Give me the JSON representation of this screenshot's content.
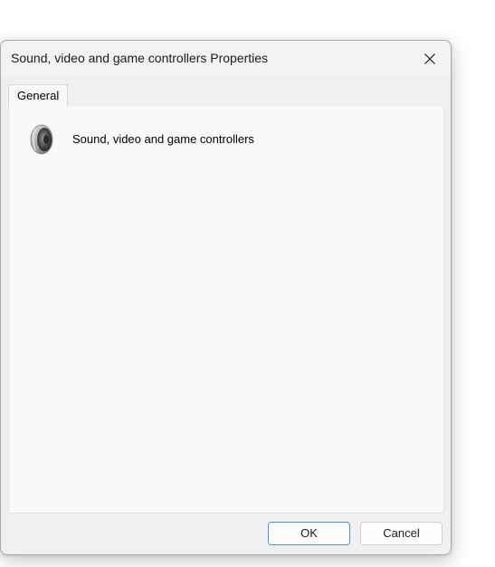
{
  "dialog": {
    "title": "Sound, video and game controllers Properties",
    "close_icon": "close-icon"
  },
  "tabs": [
    {
      "label": "General",
      "selected": true
    }
  ],
  "general": {
    "device_icon": "speaker-icon",
    "device_name": "Sound, video and game controllers"
  },
  "buttons": {
    "ok_label": "OK",
    "cancel_label": "Cancel"
  },
  "colors": {
    "accent": "#4d8ed6",
    "panel_bg": "#f9f9f9",
    "window_bg": "#f0f0f0"
  }
}
